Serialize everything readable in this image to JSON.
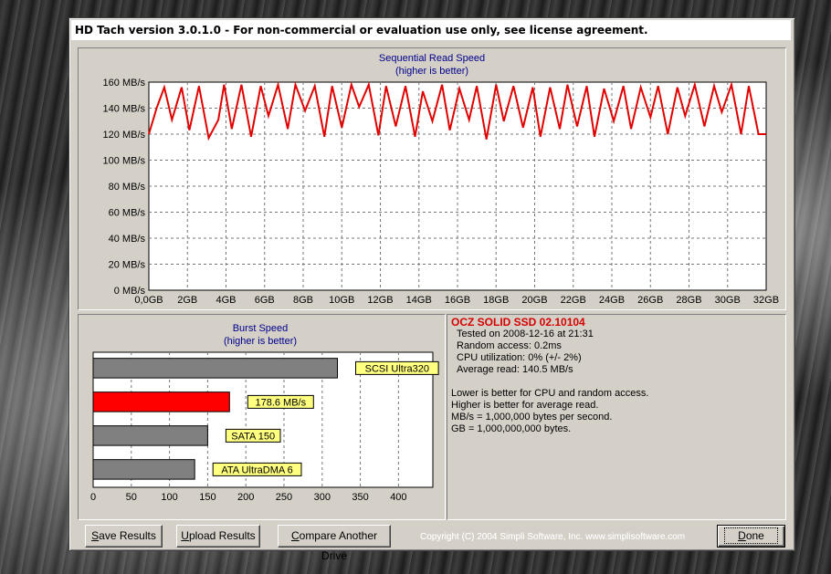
{
  "window": {
    "title": "HD Tach version 3.0.1.0  - For non-commercial or evaluation use only, see license agreement."
  },
  "seq_chart": {
    "title": "Sequential Read Speed",
    "subtitle": "(higher is better)"
  },
  "burst_chart": {
    "title": "Burst Speed",
    "subtitle": "(higher is better)"
  },
  "chart_data": [
    {
      "type": "line",
      "title": "Sequential Read Speed",
      "subtitle": "(higher is better)",
      "x_ticks": [
        "0,0GB",
        "2GB",
        "4GB",
        "6GB",
        "8GB",
        "10GB",
        "12GB",
        "14GB",
        "16GB",
        "18GB",
        "20GB",
        "22GB",
        "24GB",
        "26GB",
        "28GB",
        "30GB",
        "32GB"
      ],
      "y_ticks": [
        "0 MB/s",
        "20 MB/s",
        "40 MB/s",
        "60 MB/s",
        "80 MB/s",
        "100 MB/s",
        "120 MB/s",
        "140 MB/s",
        "160 MB/s"
      ],
      "xlim": [
        0,
        32
      ],
      "ylim": [
        0,
        160
      ],
      "grid": true,
      "series": [
        {
          "color": "#e00000",
          "x": [
            0,
            0.4,
            0.8,
            1.2,
            1.7,
            2.1,
            2.6,
            3.1,
            3.6,
            3.9,
            4.3,
            4.8,
            5.3,
            5.8,
            6.2,
            6.7,
            7.2,
            7.6,
            8.1,
            8.6,
            9.1,
            9.5,
            10.0,
            10.5,
            10.9,
            11.4,
            11.9,
            12.3,
            12.8,
            13.3,
            13.8,
            14.2,
            14.7,
            15.2,
            15.6,
            16.1,
            16.6,
            17.0,
            17.5,
            18.0,
            18.4,
            18.9,
            19.4,
            19.9,
            20.3,
            20.8,
            21.3,
            21.7,
            22.2,
            22.7,
            23.1,
            23.6,
            24.1,
            24.6,
            25.0,
            25.5,
            26.0,
            26.4,
            26.9,
            27.4,
            27.8,
            28.3,
            28.8,
            29.3,
            29.7,
            30.2,
            30.7,
            31.1,
            31.6,
            32.0
          ],
          "y": [
            120,
            140,
            156,
            131,
            156,
            123,
            157,
            117,
            131,
            158,
            124,
            158,
            118,
            157,
            134,
            158,
            124,
            158,
            138,
            157,
            118,
            157,
            125,
            158,
            141,
            158,
            119,
            157,
            126,
            157,
            118,
            153,
            130,
            158,
            123,
            155,
            131,
            157,
            116,
            158,
            130,
            157,
            125,
            156,
            118,
            156,
            124,
            158,
            126,
            157,
            118,
            155,
            130,
            157,
            124,
            156,
            133,
            157,
            120,
            156,
            134,
            158,
            126,
            157,
            137,
            158,
            120,
            157,
            120,
            120
          ]
        }
      ]
    },
    {
      "type": "bar",
      "orientation": "horizontal",
      "title": "Burst Speed",
      "subtitle": "(higher is better)",
      "x_ticks": [
        "0",
        "50",
        "100",
        "150",
        "200",
        "250",
        "300",
        "350",
        "400"
      ],
      "xlim": [
        0,
        445
      ],
      "categories": [
        "SCSI Ultra320",
        "178.6 MB/s",
        "SATA 150",
        "ATA UltraDMA 6"
      ],
      "values": [
        320,
        178.6,
        150,
        133
      ],
      "colors": [
        "#808080",
        "#ff0000",
        "#808080",
        "#808080"
      ]
    }
  ],
  "info": {
    "drive_name": "OCZ SOLID SSD 02.10104",
    "tested_on": "Tested on 2008-12-16 at 21:31",
    "random_access": "Random access: 0.2ms",
    "cpu_utilization": "CPU utilization: 0% (+/- 2%)",
    "average_read": "Average read: 140.5 MB/s",
    "note1": "Lower is better for CPU and random access.",
    "note2": "Higher is better for average read.",
    "note3": "MB/s = 1,000,000 bytes per second.",
    "note4": "GB = 1,000,000,000 bytes."
  },
  "buttons": {
    "save_prefix": "",
    "save_accel": "S",
    "save_rest": "ave Results",
    "upload_prefix": "",
    "upload_accel": "U",
    "upload_rest": "pload Results",
    "compare_prefix": "",
    "compare_accel": "C",
    "compare_rest": "ompare Another Drive",
    "done_prefix": "",
    "done_accel": "D",
    "done_rest": "one"
  },
  "copyright": "Copyright (C) 2004 Simpli Software, Inc. www.simplisoftware.com"
}
